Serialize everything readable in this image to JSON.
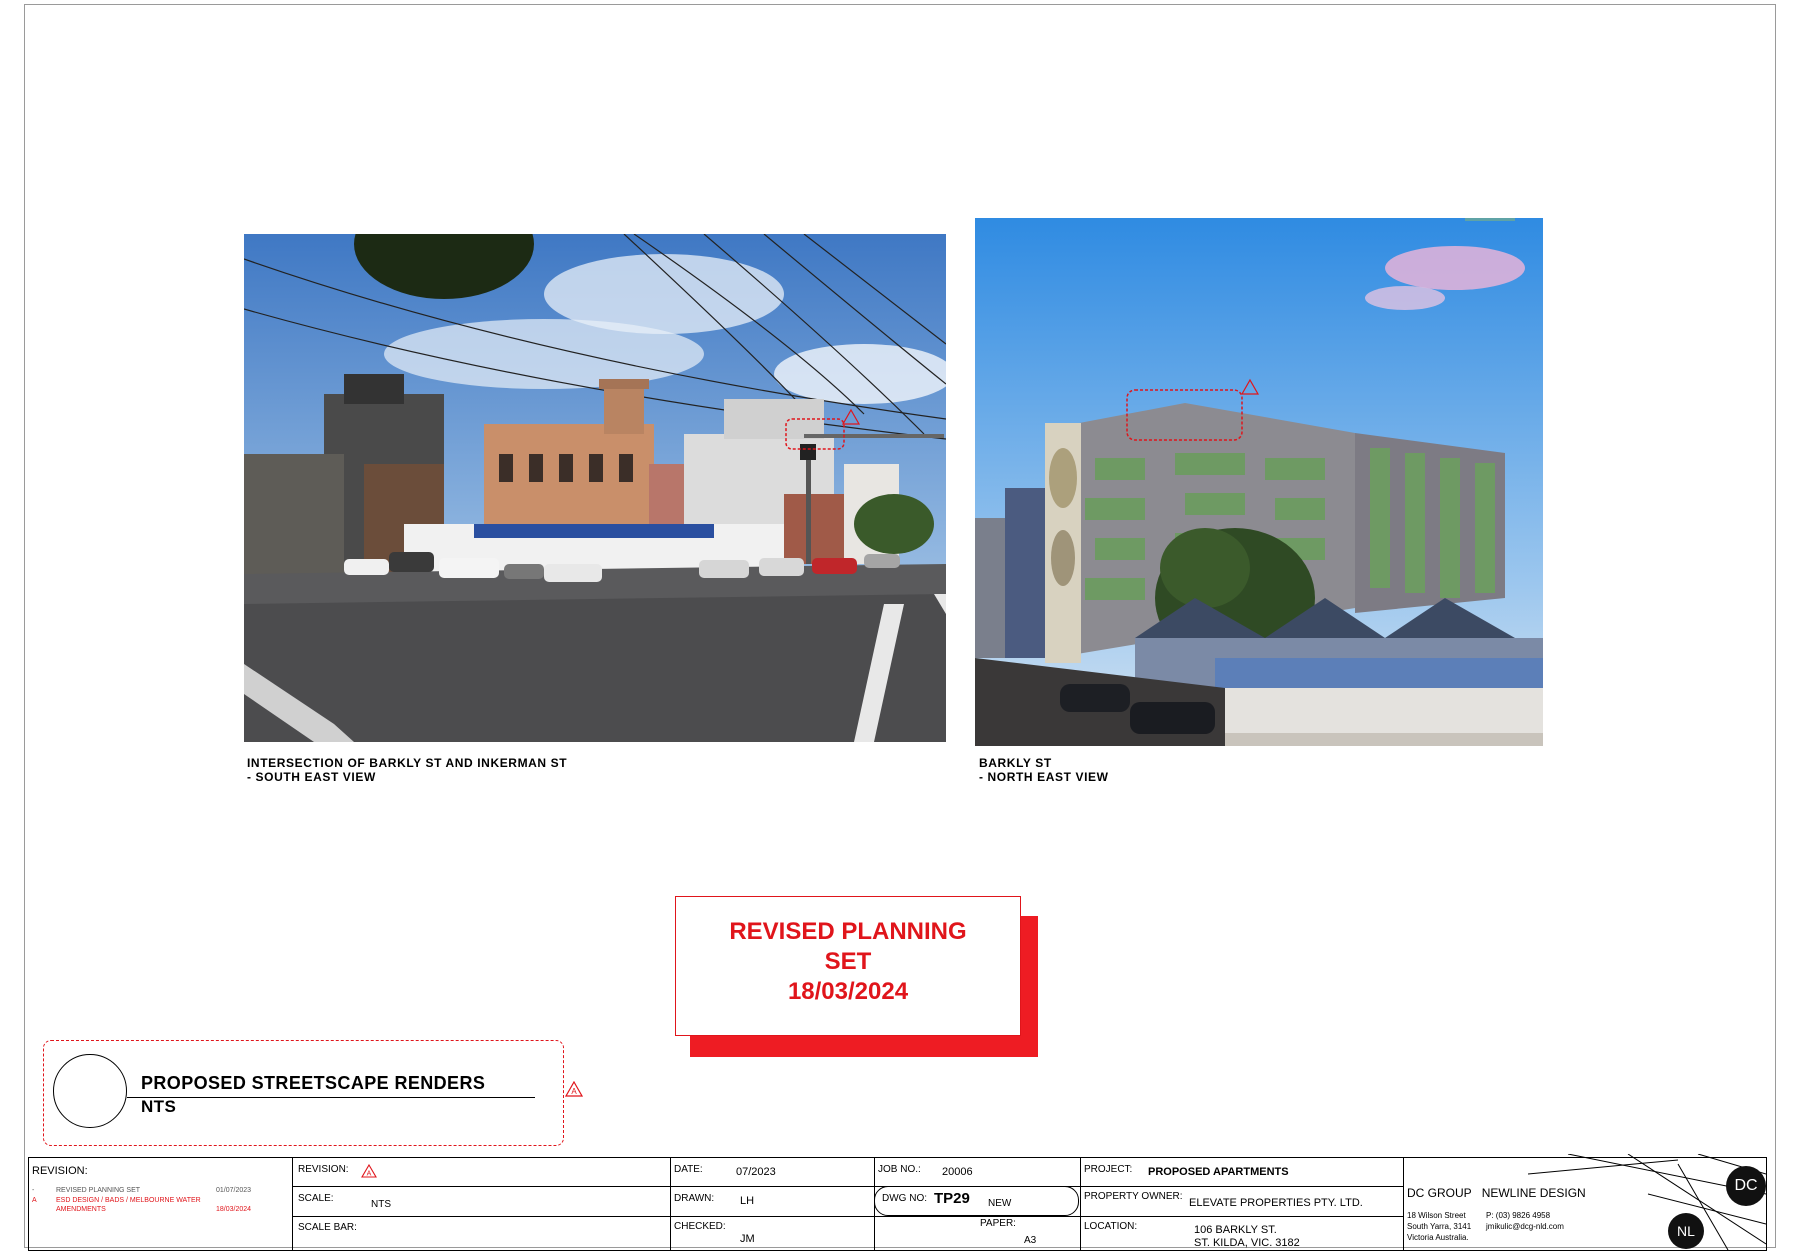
{
  "images": {
    "left": {
      "caption_line1": "INTERSECTION OF BARKLY ST AND INKERMAN ST",
      "caption_line2": "- SOUTH EAST VIEW"
    },
    "right": {
      "caption_line1": "BARKLY ST",
      "caption_line2": "- NORTH EAST VIEW"
    }
  },
  "stamp": {
    "line1": "REVISED PLANNING",
    "line2": "SET",
    "line3": "18/03/2024"
  },
  "drawing_title": {
    "title": "PROPOSED STREETSCAPE RENDERS",
    "scale": "NTS"
  },
  "title_block": {
    "revision_heading": "REVISION:",
    "revisions": [
      {
        "mark": "-",
        "desc": "REVISED PLANNING SET",
        "desc2": "",
        "date": "01/07/2023",
        "color": "#555555"
      },
      {
        "mark": "A",
        "desc": "ESD DESIGN / BADS / MELBOURNE WATER",
        "desc2": "AMENDMENTS",
        "date": "18/03/2024",
        "color": "#e0151b"
      }
    ],
    "revision_label": "REVISION:",
    "scale_label": "SCALE:",
    "scale_value": "NTS",
    "scale_bar_label": "SCALE BAR:",
    "date_label": "DATE:",
    "date_value": "07/2023",
    "drawn_label": "DRAWN:",
    "drawn_value": "LH",
    "checked_label": "CHECKED:",
    "checked_value": "JM",
    "job_label": "JOB NO.:",
    "job_value": "20006",
    "dwg_label": "DWG NO:",
    "dwg_value": "TP29",
    "dwg_status": "NEW",
    "paper_label": "PAPER:",
    "paper_value": "A3",
    "project_label": "PROJECT:",
    "project_value": "PROPOSED APARTMENTS",
    "owner_label": "PROPERTY OWNER:",
    "owner_value": "ELEVATE PROPERTIES PTY. LTD.",
    "location_label": "LOCATION:",
    "location_line1": "106 BARKLY ST.",
    "location_line2": "ST. KILDA, VIC. 3182",
    "firm1": "DC GROUP",
    "firm2": "NEWLINE DESIGN",
    "address1": "18 Wilson Street",
    "address2": "South Yarra, 3141",
    "address3": "Victoria Australia.",
    "phone": "P: (03) 9826 4958",
    "email": "jmikulic@dcg-nld.com",
    "logo1": "DC",
    "logo2": "NL"
  },
  "colors": {
    "accent_red": "#e0151b"
  }
}
